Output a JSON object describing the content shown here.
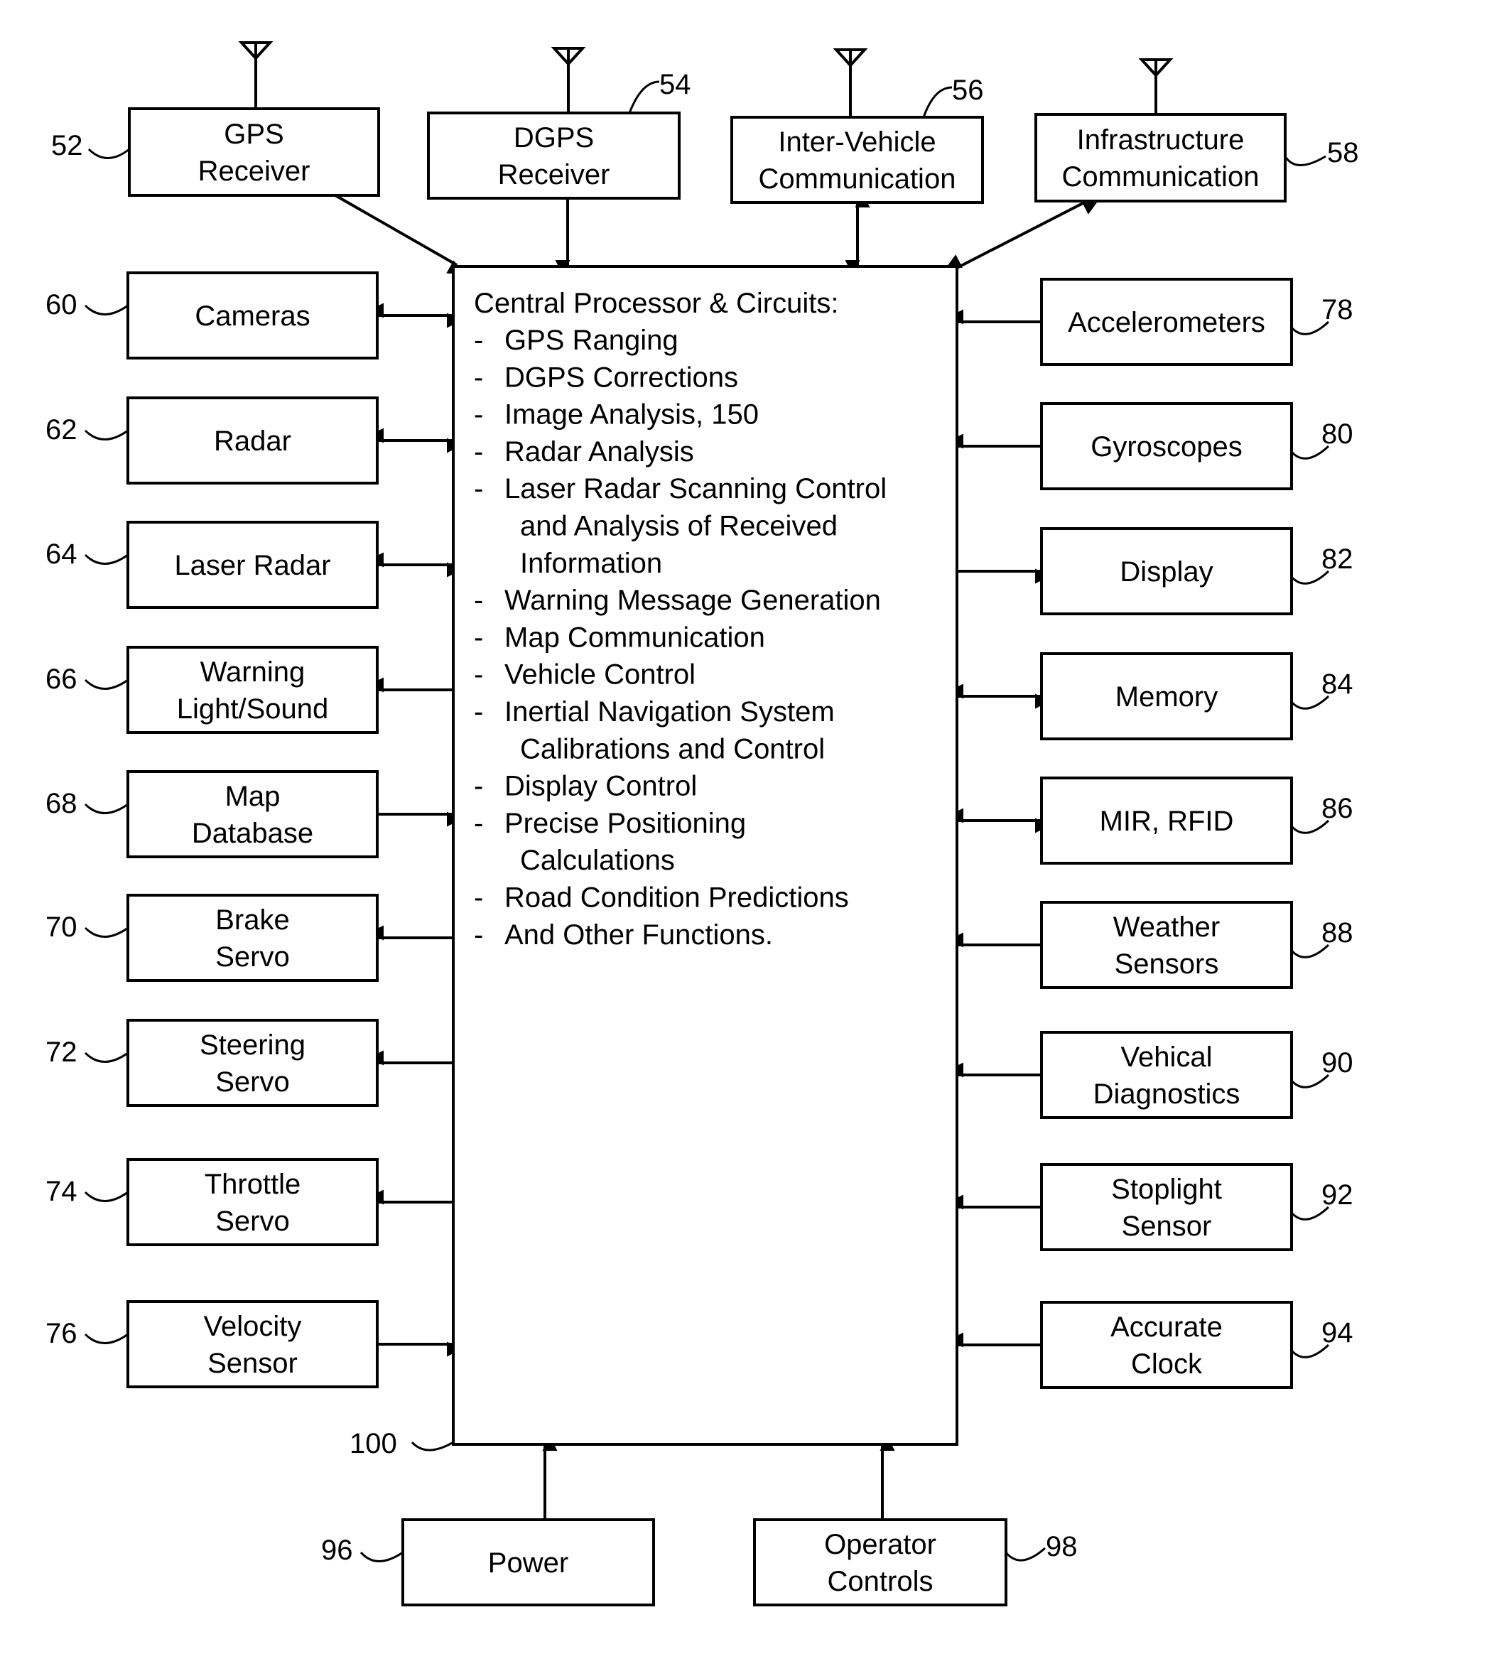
{
  "figure": {
    "central": {
      "ref": "100",
      "title": "Central Processor & Circuits:",
      "items": [
        {
          "bullet": "-",
          "lines": [
            "GPS Ranging"
          ]
        },
        {
          "bullet": "-",
          "lines": [
            "DGPS Corrections"
          ]
        },
        {
          "bullet": "-",
          "lines": [
            "Image Analysis, 150"
          ]
        },
        {
          "bullet": "-",
          "lines": [
            "Radar Analysis"
          ]
        },
        {
          "bullet": "-",
          "lines": [
            "Laser Radar Scanning Control",
            "and Analysis of Received",
            "Information"
          ]
        },
        {
          "bullet": "-",
          "lines": [
            "Warning Message Generation"
          ]
        },
        {
          "bullet": "-",
          "lines": [
            "Map Communication"
          ]
        },
        {
          "bullet": "-",
          "lines": [
            "Vehicle Control"
          ]
        },
        {
          "bullet": "-",
          "lines": [
            "Inertial Navigation System",
            "Calibrations and Control"
          ]
        },
        {
          "bullet": "-",
          "lines": [
            "Display Control"
          ]
        },
        {
          "bullet": "-",
          "lines": [
            "Precise Positioning",
            "Calculations"
          ]
        },
        {
          "bullet": "-",
          "lines": [
            "Road Condition Predictions"
          ]
        },
        {
          "bullet": "-",
          "lines": [
            "And Other Functions."
          ]
        }
      ]
    },
    "top_blocks": [
      {
        "id": "gps-receiver",
        "ref": "52",
        "lines": [
          "GPS",
          "Receiver"
        ],
        "antenna": true,
        "connection": "to-central"
      },
      {
        "id": "dgps-receiver",
        "ref": "54",
        "lines": [
          "DGPS",
          "Receiver"
        ],
        "antenna": true,
        "connection": "to-central"
      },
      {
        "id": "inter-vehicle-communication",
        "ref": "56",
        "lines": [
          "Inter-Vehicle",
          "Communication"
        ],
        "antenna": true,
        "connection": "bidirectional"
      },
      {
        "id": "infrastructure-communication",
        "ref": "58",
        "lines": [
          "Infrastructure",
          "Communication"
        ],
        "antenna": true,
        "connection": "bidirectional"
      }
    ],
    "left_blocks": [
      {
        "id": "cameras",
        "ref": "60",
        "lines": [
          "Cameras"
        ],
        "connection": "bidirectional"
      },
      {
        "id": "radar",
        "ref": "62",
        "lines": [
          "Radar"
        ],
        "connection": "bidirectional"
      },
      {
        "id": "laser-radar",
        "ref": "64",
        "lines": [
          "Laser Radar"
        ],
        "connection": "bidirectional"
      },
      {
        "id": "warning-light-sound",
        "ref": "66",
        "lines": [
          "Warning",
          "Light/Sound"
        ],
        "connection": "from-central"
      },
      {
        "id": "map-database",
        "ref": "68",
        "lines": [
          "Map",
          "Database"
        ],
        "connection": "to-central"
      },
      {
        "id": "brake-servo",
        "ref": "70",
        "lines": [
          "Brake",
          "Servo"
        ],
        "connection": "from-central"
      },
      {
        "id": "steering-servo",
        "ref": "72",
        "lines": [
          "Steering",
          "Servo"
        ],
        "connection": "from-central"
      },
      {
        "id": "throttle-servo",
        "ref": "74",
        "lines": [
          "Throttle",
          "Servo"
        ],
        "connection": "from-central"
      },
      {
        "id": "velocity-sensor",
        "ref": "76",
        "lines": [
          "Velocity",
          "Sensor"
        ],
        "connection": "to-central"
      }
    ],
    "right_blocks": [
      {
        "id": "accelerometers",
        "ref": "78",
        "lines": [
          "Accelerometers"
        ],
        "connection": "to-central"
      },
      {
        "id": "gyroscopes",
        "ref": "80",
        "lines": [
          "Gyroscopes"
        ],
        "connection": "to-central"
      },
      {
        "id": "display",
        "ref": "82",
        "lines": [
          "Display"
        ],
        "connection": "from-central"
      },
      {
        "id": "memory",
        "ref": "84",
        "lines": [
          "Memory"
        ],
        "connection": "bidirectional"
      },
      {
        "id": "mir-rfid",
        "ref": "86",
        "lines": [
          "MIR, RFID"
        ],
        "connection": "bidirectional"
      },
      {
        "id": "weather-sensors",
        "ref": "88",
        "lines": [
          "Weather",
          "Sensors"
        ],
        "connection": "to-central"
      },
      {
        "id": "vehical-diagnostics",
        "ref": "90",
        "lines": [
          "Vehical",
          "Diagnostics"
        ],
        "connection": "to-central"
      },
      {
        "id": "stoplight-sensor",
        "ref": "92",
        "lines": [
          "Stoplight",
          "Sensor"
        ],
        "connection": "to-central"
      },
      {
        "id": "accurate-clock",
        "ref": "94",
        "lines": [
          "Accurate",
          "Clock"
        ],
        "connection": "to-central"
      }
    ],
    "bottom_blocks": [
      {
        "id": "power",
        "ref": "96",
        "lines": [
          "Power"
        ],
        "connection": "to-central"
      },
      {
        "id": "operator-controls",
        "ref": "98",
        "lines": [
          "Operator",
          "Controls"
        ],
        "connection": "to-central"
      }
    ]
  }
}
